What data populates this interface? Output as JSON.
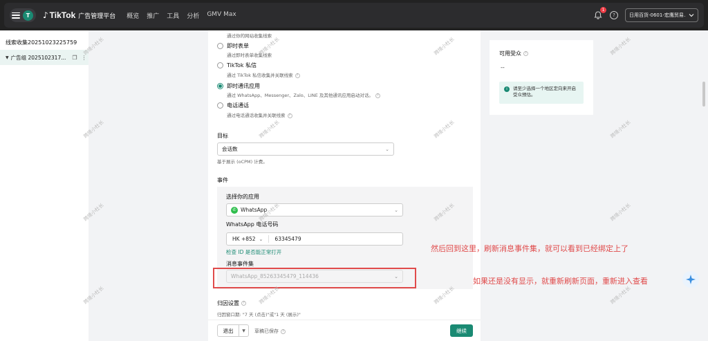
{
  "topbar": {
    "avatar_letter": "T",
    "brand_name": "TikTok",
    "brand_sub": "广告管理平台",
    "nav": [
      "概览",
      "推广",
      "工具",
      "分析",
      "GMV Max"
    ],
    "notification_count": "1",
    "help_symbol": "?",
    "account_name": "日用百货-0601-宏鹰贸易..."
  },
  "sidebar": {
    "campaign_title": "线索收集20251023225759",
    "adgroup_label": "广告组 2025102317..."
  },
  "form": {
    "options": [
      {
        "label": "",
        "desc": "通过你的网站收集线索",
        "selected": false
      },
      {
        "label": "即时表单",
        "desc": "通过即时表单收集线索",
        "selected": false
      },
      {
        "label": "TikTok 私信",
        "desc": "通过 TikTok 私信收集并关联线索",
        "selected": false
      },
      {
        "label": "即时通讯应用",
        "desc": "通过 WhatsApp、Messenger、Zalo、LINE 及其他通讯应用启动对话。",
        "selected": true
      },
      {
        "label": "电话通话",
        "desc": "通过电话通话收集并关联线索",
        "selected": false
      }
    ],
    "goal_label": "目标",
    "goal_value": "会话数",
    "goal_hint": "基于展示 (oCPM) 计费。",
    "event_label": "事件",
    "choose_app_label": "选择你的应用",
    "app_value": "WhatsApp",
    "phone_label": "WhatsApp 电话号码",
    "country_code": "HK +852",
    "phone_number": "63345479",
    "check_link": "检查 ID 是否能正常打开",
    "event_set_label": "消息事件集",
    "event_set_value": "WhatsApp_85263345479_114436",
    "attribution_label": "归因设置",
    "attribution_desc": "归因窗口期: \"7 天 (点击)\"或\"1 天 (展示)\"",
    "exit_label": "退出",
    "draft_label": "草稿已保存",
    "continue_label": "继续"
  },
  "audience": {
    "title": "可用受众",
    "value": "--",
    "info": "请至少选择一个地区定向来开启受众预估。"
  },
  "annotations": {
    "line1": "然后回到这里，刷新消息事件集，就可以看到已经绑定上了",
    "line2": "如果还是没有显示，就重新刷新页面，重新进入查看"
  },
  "watermark": "跨境小杜长",
  "colors": {
    "accent": "#1a8a73",
    "annotation": "#e04a4a",
    "whatsapp": "#2fbe4d"
  },
  "icons": {
    "menu": "hamburger-icon",
    "bell": "bell-icon",
    "help": "help-icon",
    "copy": "copy-icon",
    "more": "more-icon",
    "sparkle": "sparkle-icon"
  }
}
